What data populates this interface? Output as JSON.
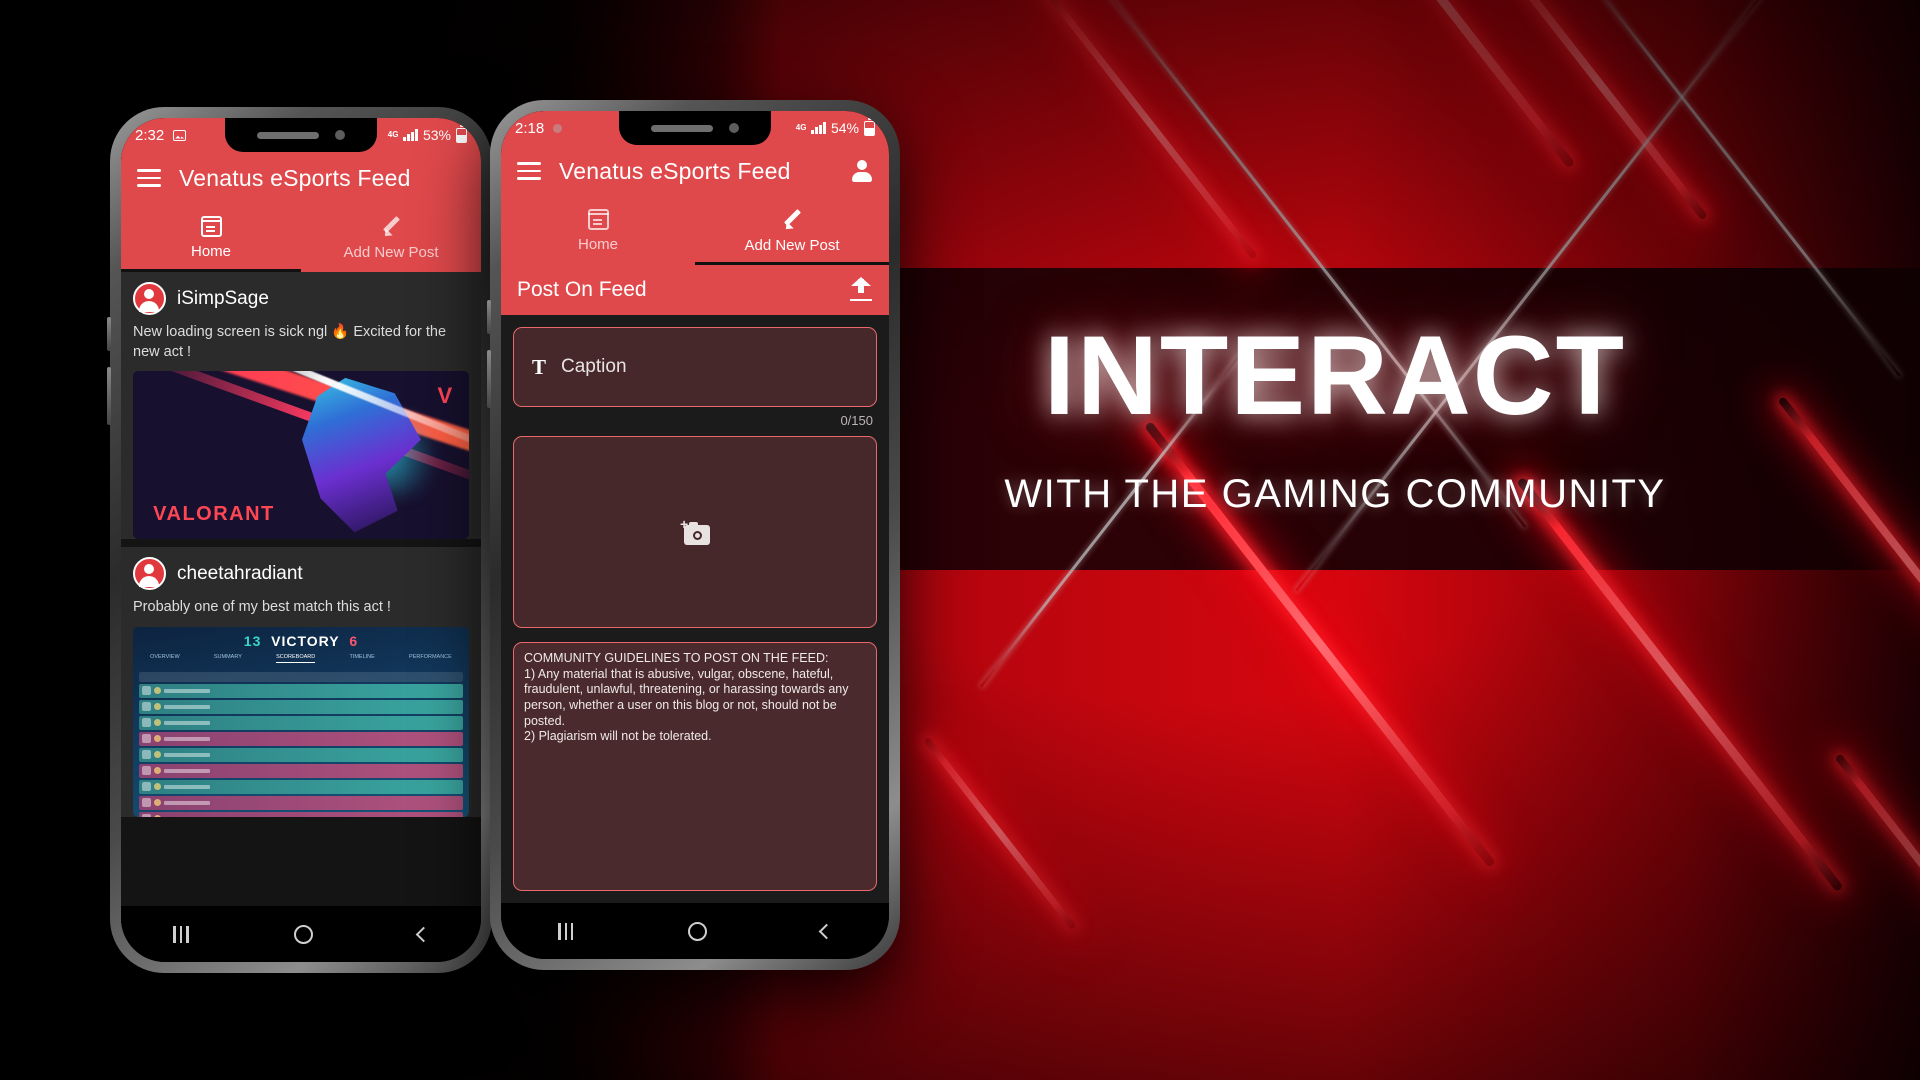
{
  "background": {
    "headline": "INTERACT",
    "subhead": "WITH THE GAMING COMMUNITY",
    "accent_red": "#d6060f",
    "app_red": "#e0494c"
  },
  "phone_left": {
    "status": {
      "time": "2:32",
      "photo_icon": "photo-icon",
      "network": "4G",
      "signal_icon": "signal-icon",
      "battery": "53%"
    },
    "appbar": {
      "menu_icon": "hamburger-icon",
      "title": "Venatus eSports Feed"
    },
    "tabs": [
      {
        "label": "Home",
        "icon": "calendar-icon",
        "active": true
      },
      {
        "label": "Add New Post",
        "icon": "pencil-icon",
        "active": false
      }
    ],
    "posts": [
      {
        "user": "iSimpSage",
        "text": "New loading screen is sick ngl 🔥 Excited for the new act !",
        "image": "valorant-key-art",
        "image_caption": "VALORANT",
        "image_mark": "V"
      },
      {
        "user": "cheetahradiant",
        "text": "Probably one of my best match this act !",
        "image": "valorant-scoreboard",
        "score_left": "13",
        "score_result": "VICTORY",
        "score_right": "6",
        "score_tabs": [
          "OVERVIEW",
          "SUMMARY",
          "SCOREBOARD",
          "TIMELINE",
          "PERFORMANCE"
        ]
      }
    ],
    "navbar": {
      "recents_icon": "recents-icon",
      "home_icon": "home-circle-icon",
      "back_icon": "back-chevron-icon"
    }
  },
  "phone_right": {
    "status": {
      "time": "2:18",
      "record_icon": "record-dot-icon",
      "network": "4G",
      "signal_icon": "signal-icon",
      "battery": "54%"
    },
    "appbar": {
      "menu_icon": "hamburger-icon",
      "title": "Venatus eSports Feed",
      "profile_icon": "person-icon"
    },
    "tabs": [
      {
        "label": "Home",
        "icon": "calendar-icon",
        "active": false
      },
      {
        "label": "Add New Post",
        "icon": "pencil-icon",
        "active": true
      }
    ],
    "postbar": {
      "title": "Post On Feed",
      "upload_icon": "upload-icon"
    },
    "compose": {
      "caption_icon": "text-format-icon",
      "caption_placeholder": "Caption",
      "caption_value": "",
      "counter": "0/150",
      "image_picker_icon": "add-photo-icon",
      "guidelines": "COMMUNITY GUIDELINES TO POST ON THE FEED:\n1) Any material that is abusive, vulgar, obscene, hateful, fraudulent, unlawful, threatening, or harassing towards any person, whether a user on this blog or not, should not be posted.\n2) Plagiarism will not be tolerated."
    },
    "navbar": {
      "recents_icon": "recents-icon",
      "home_icon": "home-circle-icon",
      "back_icon": "back-chevron-icon"
    }
  }
}
